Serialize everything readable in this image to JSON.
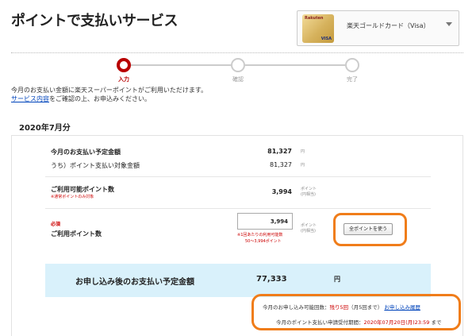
{
  "page": {
    "title": "ポイントで支払いサービス"
  },
  "card_select": {
    "brand": "Rakuten",
    "card_visa": "VISA",
    "selected": "楽天ゴールドカード（Visa）"
  },
  "steps": [
    {
      "label": "入力",
      "active": true
    },
    {
      "label": "確認",
      "active": false
    },
    {
      "label": "完了",
      "active": false
    }
  ],
  "intro": {
    "line1": "今月のお支払い金額に楽天スーパーポイントがご利用いただけます。",
    "link": "サービス内容",
    "line2_rest": "をご確認の上、お申込みください。"
  },
  "month": "2020年7月分",
  "summary": {
    "scheduled_label": "今月のお支払い予定金額",
    "scheduled_value": "81,327",
    "scheduled_unit": "円",
    "eligible_label": "うち）ポイント支払い対象金額",
    "eligible_value": "81,327",
    "eligible_unit": "円",
    "available_label": "ご利用可能ポイント数",
    "available_note": "※通常ポイントのみ対象",
    "available_value": "3,994",
    "available_unit1": "ポイント",
    "available_unit2": "(円相当)"
  },
  "use_points": {
    "required": "必須",
    "label": "ご利用ポイント数",
    "input_value": "3,994",
    "limit_note1": "※1回あたりの利用可能数",
    "limit_note2": "50～3,994ポイント",
    "unit1": "ポイント",
    "unit2": "(円相当)",
    "use_all_button": "全ポイントを使う"
  },
  "total": {
    "label": "お申し込み後のお支払い予定金額",
    "value": "77,333",
    "unit": "円"
  },
  "info": {
    "line1_prefix": "今月のお申し込み可能回数：",
    "remaining": "残り5回",
    "line1_mid": "（月5回まで）",
    "history_link": "お申し込み履歴",
    "line2_prefix": "今月のポイント支払い申請受付期間：",
    "deadline": "2020年07月20日(月)23:59",
    "line2_suffix": "まで"
  },
  "colors": {
    "accent_red": "#b80000",
    "highlight_orange": "#f07d1a",
    "total_bg": "#d9f1fb",
    "link_blue": "#0044bb"
  }
}
